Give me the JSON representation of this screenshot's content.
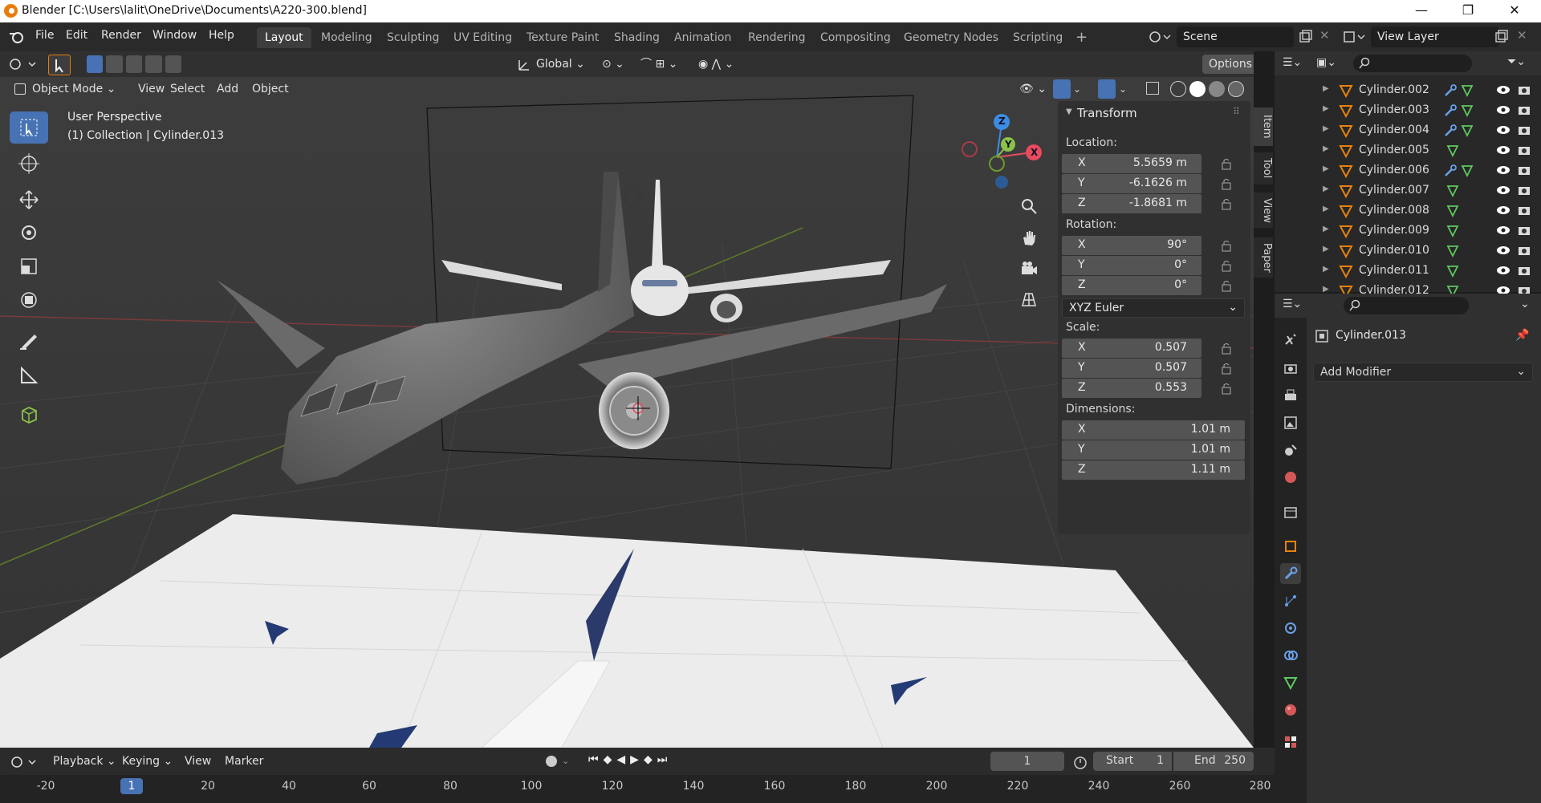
{
  "window": {
    "title": "Blender [C:\\Users\\lalit\\OneDrive\\Documents\\A220-300.blend]",
    "controls": [
      "—",
      "❐",
      "✕"
    ]
  },
  "menu": {
    "items": [
      "File",
      "Edit",
      "Render",
      "Window",
      "Help"
    ],
    "workspaces": [
      "Layout",
      "Modeling",
      "Sculpting",
      "UV Editing",
      "Texture Paint",
      "Shading",
      "Animation",
      "Rendering",
      "Compositing",
      "Geometry Nodes",
      "Scripting"
    ],
    "active_workspace": "Layout",
    "add_workspace": "+",
    "scene": "Scene",
    "view_layer": "View Layer"
  },
  "viewport": {
    "transform_orientation": "Global",
    "options": "Options",
    "mode": "Object Mode",
    "header_menus": [
      "View",
      "Select",
      "Add",
      "Object"
    ],
    "perspective_label": "User Perspective",
    "object_label": "(1) Collection | Cylinder.013",
    "gizmo_axes": [
      "Z",
      "Y",
      "X"
    ]
  },
  "npanel": {
    "tabs": [
      "Item",
      "Tool",
      "View",
      "Paper"
    ],
    "header": "Transform",
    "location_label": "Location:",
    "location": [
      {
        "axis": "X",
        "value": "5.5659 m"
      },
      {
        "axis": "Y",
        "value": "-6.1626 m"
      },
      {
        "axis": "Z",
        "value": "-1.8681 m"
      }
    ],
    "rotation_label": "Rotation:",
    "rotation": [
      {
        "axis": "X",
        "value": "90°"
      },
      {
        "axis": "Y",
        "value": "0°"
      },
      {
        "axis": "Z",
        "value": "0°"
      }
    ],
    "rotation_mode": "XYZ Euler",
    "scale_label": "Scale:",
    "scale": [
      {
        "axis": "X",
        "value": "0.507"
      },
      {
        "axis": "Y",
        "value": "0.507"
      },
      {
        "axis": "Z",
        "value": "0.553"
      }
    ],
    "dimensions_label": "Dimensions:",
    "dimensions": [
      {
        "axis": "X",
        "value": "1.01 m"
      },
      {
        "axis": "Y",
        "value": "1.01 m"
      },
      {
        "axis": "Z",
        "value": "1.11 m"
      }
    ]
  },
  "outliner": {
    "rows": [
      {
        "name": "Cylinder.002",
        "has_modifier": true
      },
      {
        "name": "Cylinder.003",
        "has_modifier": true
      },
      {
        "name": "Cylinder.004",
        "has_modifier": true
      },
      {
        "name": "Cylinder.005",
        "has_modifier": false
      },
      {
        "name": "Cylinder.006",
        "has_modifier": true
      },
      {
        "name": "Cylinder.007",
        "has_modifier": false
      },
      {
        "name": "Cylinder.008",
        "has_modifier": false
      },
      {
        "name": "Cylinder.009",
        "has_modifier": false
      },
      {
        "name": "Cylinder.010",
        "has_modifier": false
      },
      {
        "name": "Cylinder.011",
        "has_modifier": false
      },
      {
        "name": "Cylinder.012",
        "has_modifier": false
      }
    ]
  },
  "properties": {
    "object_name": "Cylinder.013",
    "add_modifier": "Add Modifier"
  },
  "timeline": {
    "menus": [
      "Playback",
      "Keying",
      "View",
      "Marker"
    ],
    "current_frame": "1",
    "start_label": "Start",
    "start": "1",
    "end_label": "End",
    "end": "250",
    "ruler": [
      "-20",
      "1",
      "20",
      "40",
      "60",
      "80",
      "100",
      "120",
      "140",
      "160",
      "180",
      "200",
      "220",
      "240",
      "260",
      "280"
    ]
  },
  "colors": {
    "accent": "#4772b3",
    "x_axis": "#e84a5f",
    "y_axis": "#8bc34a",
    "z_axis": "#3c8ce6",
    "active_object": "#e8820d"
  }
}
